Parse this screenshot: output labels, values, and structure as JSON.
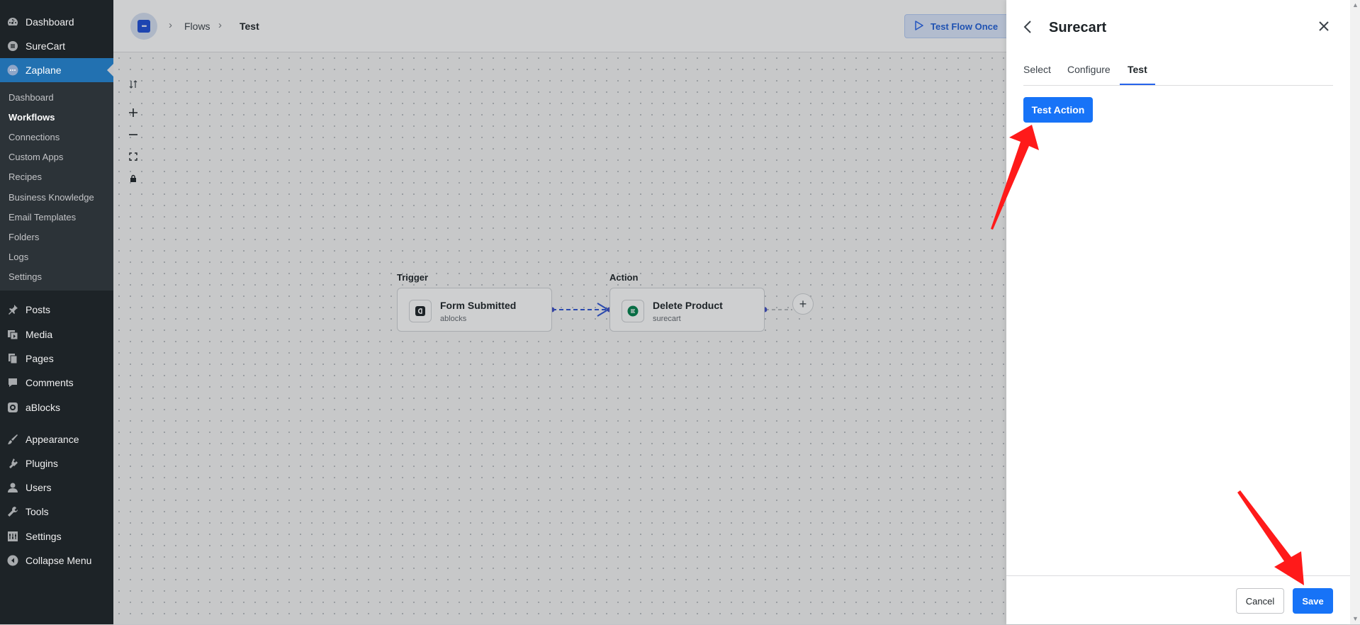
{
  "sidebar": {
    "top_items": [
      {
        "label": "Dashboard",
        "icon": "dashboard-icon"
      },
      {
        "label": "SureCart",
        "icon": "surecart-icon"
      },
      {
        "label": "Zaplane",
        "icon": "zaplane-icon",
        "current": true
      }
    ],
    "submenu": [
      "Dashboard",
      "Workflows",
      "Connections",
      "Custom Apps",
      "Recipes",
      "Business Knowledge",
      "Email Templates",
      "Folders",
      "Logs",
      "Settings"
    ],
    "submenu_active": "Workflows",
    "items": [
      {
        "label": "Posts",
        "icon": "pin-icon"
      },
      {
        "label": "Media",
        "icon": "media-icon"
      },
      {
        "label": "Pages",
        "icon": "pages-icon"
      },
      {
        "label": "Comments",
        "icon": "comments-icon"
      },
      {
        "label": "aBlocks",
        "icon": "ablocks-icon"
      },
      {
        "label": "Appearance",
        "icon": "brush-icon"
      },
      {
        "label": "Plugins",
        "icon": "plugin-icon"
      },
      {
        "label": "Users",
        "icon": "user-icon"
      },
      {
        "label": "Tools",
        "icon": "wrench-icon"
      },
      {
        "label": "Settings",
        "icon": "settings-icon"
      },
      {
        "label": "Collapse Menu",
        "icon": "collapse-icon"
      }
    ]
  },
  "header": {
    "breadcrumbs": [
      "Flows",
      "Test"
    ],
    "test_flow_label": "Test Flow Once"
  },
  "canvas": {
    "trigger_label": "Trigger",
    "action_label": "Action",
    "trigger_node": {
      "title": "Form Submitted",
      "subtitle": "ablocks"
    },
    "action_node": {
      "title": "Delete Product",
      "subtitle": "surecart"
    }
  },
  "panel": {
    "title": "Surecart",
    "tabs": [
      "Select",
      "Configure",
      "Test"
    ],
    "active_tab": "Test",
    "test_action_label": "Test Action",
    "cancel_label": "Cancel",
    "save_label": "Save"
  },
  "colors": {
    "accent": "#1773f7",
    "wp_sidebar": "#1d2327",
    "wp_current": "#2271b1",
    "annotation_arrow": "#ff1a1a"
  }
}
